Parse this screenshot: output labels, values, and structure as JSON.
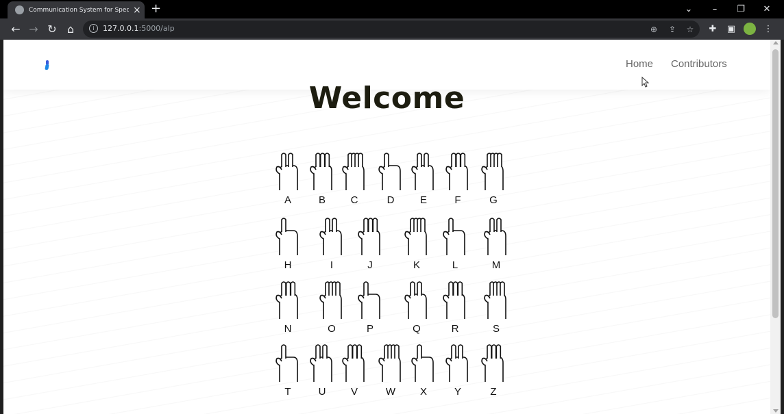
{
  "browser": {
    "tab_title": "Communication System for Specially",
    "url_host": "127.0.0.1",
    "url_path": ":5000/alp"
  },
  "site": {
    "nav": [
      "Home",
      "Contributors"
    ],
    "heading": "Welcome"
  },
  "alphabet_chart": {
    "rows": [
      [
        "A",
        "B",
        "C",
        "D",
        "E",
        "F",
        "G"
      ],
      [
        "H",
        "I",
        "J",
        "K",
        "L",
        "M"
      ],
      [
        "N",
        "O",
        "P",
        "Q",
        "R",
        "S"
      ],
      [
        "T",
        "U",
        "V",
        "W",
        "X",
        "Y",
        "Z"
      ]
    ]
  }
}
